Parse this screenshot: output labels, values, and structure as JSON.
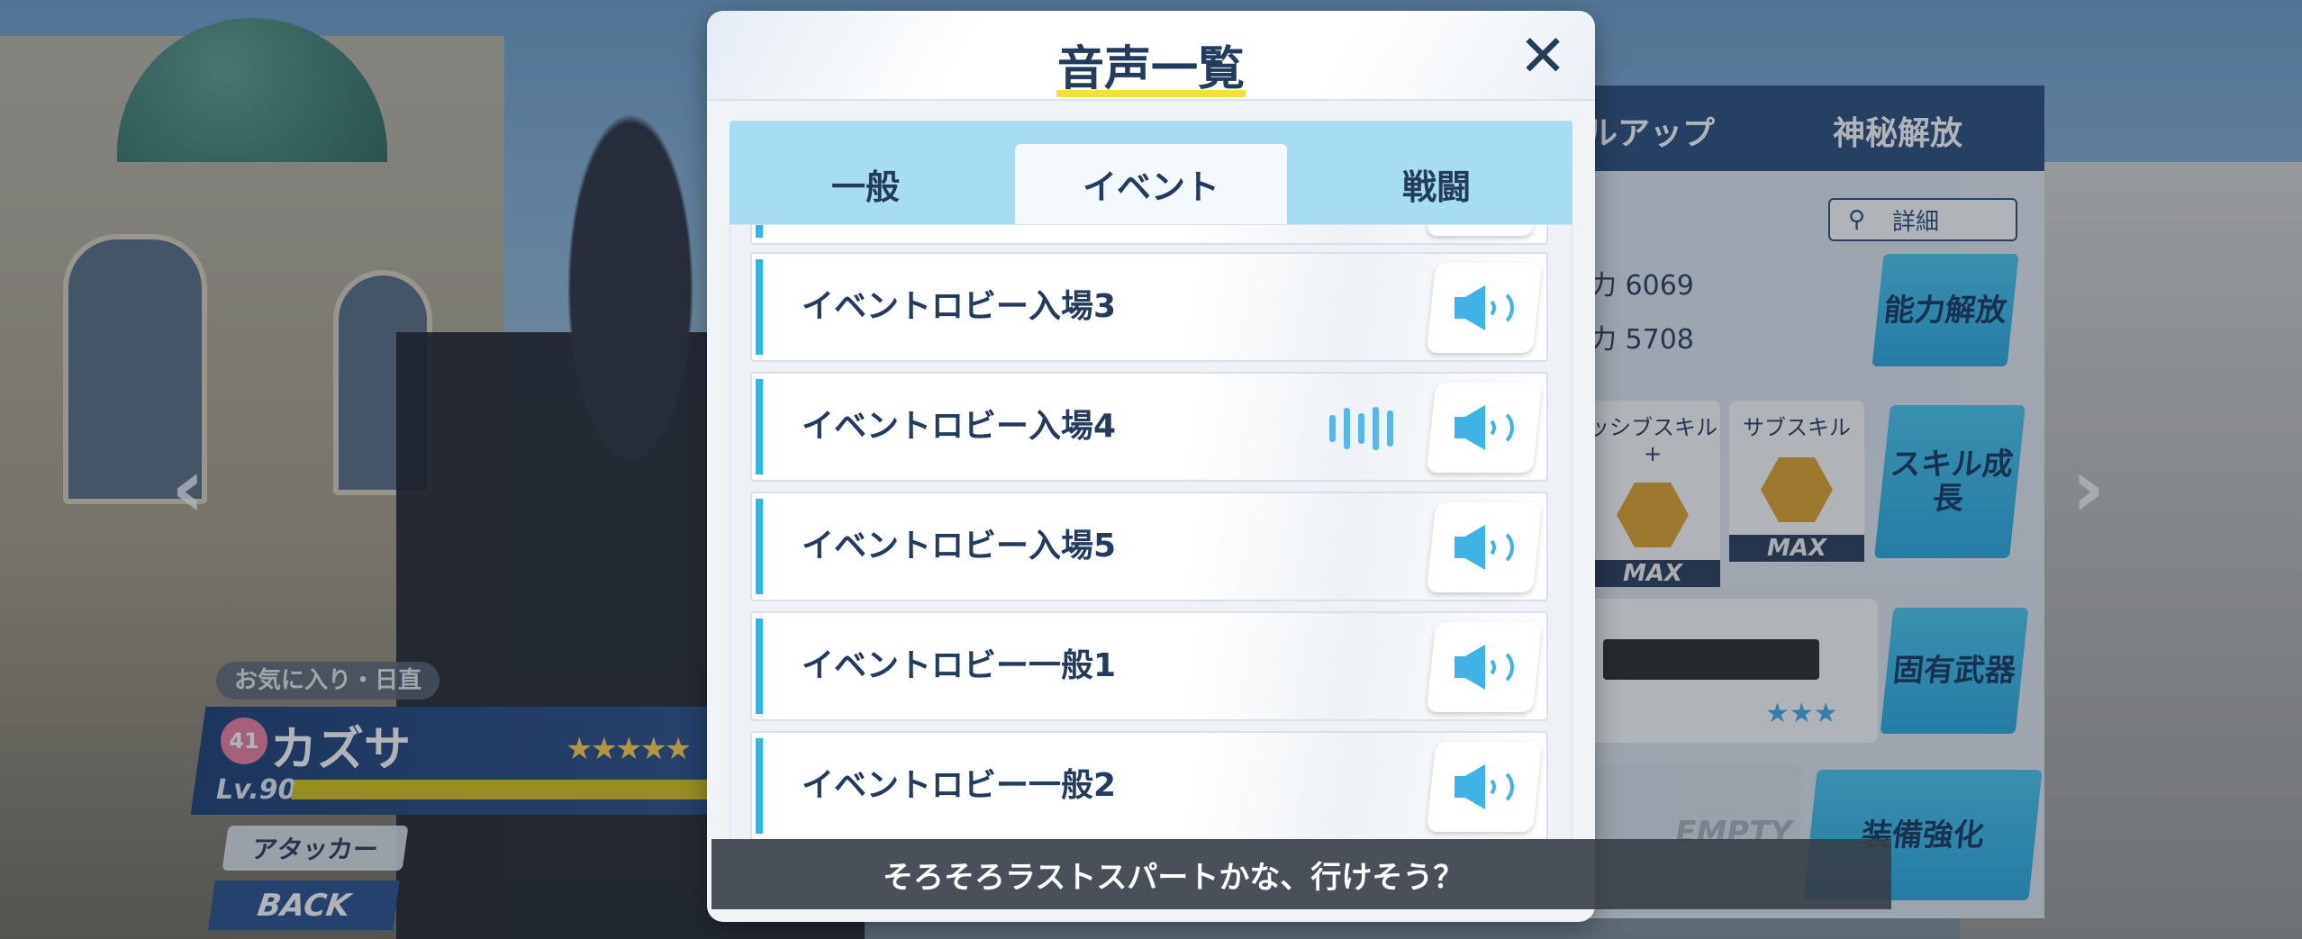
{
  "modal": {
    "title": "音声一覧",
    "close_glyph": "✕",
    "tabs": [
      {
        "label": "一般",
        "active": false
      },
      {
        "label": "イベント",
        "active": true
      },
      {
        "label": "戦闘",
        "active": false
      }
    ],
    "voice_items": [
      {
        "label": "イベントロビー入場3",
        "playing": false
      },
      {
        "label": "イベントロビー入場4",
        "playing": true
      },
      {
        "label": "イベントロビー入場5",
        "playing": false
      },
      {
        "label": "イベントロビー一般1",
        "playing": false
      },
      {
        "label": "イベントロビー一般2",
        "playing": false
      }
    ]
  },
  "subtitle": "そろそろラストスパートかな、行けそう？",
  "character": {
    "favorite_tag": "お気に入り・日直",
    "affection": "41",
    "name": "カズサ",
    "stars": "★★★★★",
    "level": "Lv.90",
    "role": "アタッカー",
    "back_label": "BACK"
  },
  "right_panel": {
    "tab_levelup": "ルアップ",
    "tab_mystic": "神秘解放",
    "search_label": "詳細",
    "stat1": "力 6069",
    "stat2": "力 5708",
    "ability_btn": "能力解放",
    "skill_label": "ッシブスキル+",
    "sub_skill_label": "サブスキル",
    "max_label": "MAX",
    "skill_btn": "スキル成長",
    "weapon_btn": "固有武器",
    "weapon_stars": "★★★",
    "empty_label": "EMPTY",
    "equip_btn": "装備強化"
  },
  "colors": {
    "accent_cyan": "#29b8ee",
    "title_navy": "#233b5d",
    "tab_bg": "#a6ddf4",
    "underline_yellow": "#f3e13a"
  },
  "icons": {
    "close": "close-icon",
    "play": "speaker-icon",
    "playing": "sound-wave-icon",
    "search": "search-icon"
  }
}
